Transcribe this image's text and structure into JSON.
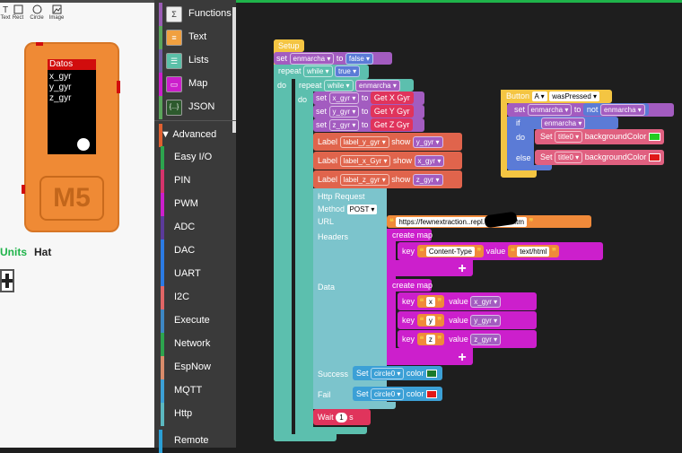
{
  "toolbar": {
    "tools": [
      {
        "label": "Text",
        "icon": "text-tool-icon"
      },
      {
        "label": "Rect",
        "icon": "rect-tool-icon"
      },
      {
        "label": "Circle",
        "icon": "circle-tool-icon"
      },
      {
        "label": "Image",
        "icon": "image-tool-icon"
      }
    ]
  },
  "device": {
    "screen_header": "Datos",
    "screen_lines": [
      "x_gyr",
      "y_gyr",
      "z_gyr"
    ],
    "logo": "M5"
  },
  "tabs": {
    "units": "Units",
    "hat": "Hat",
    "add": "+"
  },
  "categories": {
    "basic": [
      {
        "label": "Functions",
        "color": "#9a5cb4",
        "icon": "Σ"
      },
      {
        "label": "Text",
        "color": "#5ba55b",
        "icon": "≡"
      },
      {
        "label": "Lists",
        "color": "#745ba5",
        "icon": "☰"
      },
      {
        "label": "Map",
        "color": "#cc1fcc",
        "icon": "▭"
      },
      {
        "label": "JSON",
        "color": "#5ba55b",
        "icon": "{...}"
      }
    ],
    "advanced_label": "Advanced",
    "advanced": [
      {
        "label": "Easy I/O",
        "color": "#2da44e"
      },
      {
        "label": "PIN",
        "color": "#d6336c"
      },
      {
        "label": "PWM",
        "color": "#cc1fcc"
      },
      {
        "label": "ADC",
        "color": "#5b3a9a"
      },
      {
        "label": "DAC",
        "color": "#2b7be4"
      },
      {
        "label": "UART",
        "color": "#2b7be4"
      },
      {
        "label": "I2C",
        "color": "#e06666"
      },
      {
        "label": "Execute",
        "color": "#3d87c4"
      },
      {
        "label": "Network",
        "color": "#2da44e"
      },
      {
        "label": "EspNow",
        "color": "#d98c6b"
      },
      {
        "label": "MQTT",
        "color": "#3ca0d6"
      },
      {
        "label": "Http",
        "color": "#5bb8c0"
      },
      {
        "label": "Remote",
        "color": "#2b9fd6"
      }
    ]
  },
  "colors": {
    "setup": "#f4c542",
    "variable": "#a35cc0",
    "loop": "#5cbfae",
    "logic": "#5b7bd6",
    "label": "#e0644c",
    "imu": "#e0345c",
    "http": "#7cc4cc",
    "map": "#cc1fcc",
    "text": "#f08a3a",
    "button": "#f4c542",
    "event": "#e06080"
  },
  "blocks": {
    "setup": "Setup",
    "set1": {
      "kw": "set",
      "var": "enmarcha",
      "to": "to",
      "val": "false"
    },
    "repeat1": {
      "kw": "repeat",
      "mode": "while",
      "val": "true"
    },
    "do": "do",
    "repeat2": {
      "kw": "repeat",
      "mode": "while",
      "var": "enmarcha"
    },
    "gyro": [
      {
        "var": "x_gyr",
        "get": "Get X Gyr"
      },
      {
        "var": "y_gyr",
        "get": "Get Y Gyr"
      },
      {
        "var": "z_gyr",
        "get": "Get Z Gyr"
      }
    ],
    "labels": [
      {
        "name": "label_y_gyr",
        "var": "y_gyr"
      },
      {
        "name": "label_x_Gyr",
        "var": "x_gyr"
      },
      {
        "name": "label_z_gyr",
        "var": "z_gyr"
      }
    ],
    "label_kw": "Label",
    "show_kw": "show",
    "to_kw": "to",
    "http": {
      "title": "Http Request",
      "method_label": "Method",
      "method": "POST",
      "url_label": "URL",
      "url": "https://fewnextraction..repl.co/toma.htm",
      "headers_label": "Headers",
      "data_label": "Data",
      "success_label": "Success",
      "fail_label": "Fail"
    },
    "create_map": "create map",
    "key_kw": "key",
    "value_kw": "value",
    "header_entry": {
      "key": "Content-Type",
      "value": "text/html"
    },
    "data_entries": [
      {
        "key": "x",
        "value": "x_gyr"
      },
      {
        "key": "y",
        "value": "y_gyr"
      },
      {
        "key": "z",
        "value": "z_gyr"
      }
    ],
    "success_set": {
      "kw": "Set",
      "target": "circle0",
      "prop": "color",
      "color": "#1a7a2a"
    },
    "fail_set": {
      "kw": "Set",
      "target": "circle0",
      "prop": "color",
      "color": "#e01818"
    },
    "wait": {
      "kw": "Wait",
      "val": "1",
      "unit": "s"
    },
    "button": {
      "kw": "Button",
      "btn": "A",
      "event": "wasPressed"
    },
    "set2": {
      "kw": "set",
      "var": "enmarcha",
      "to": "to",
      "not": "not",
      "val": "enmarcha"
    },
    "if_kw": "if",
    "if_var": "enmarcha",
    "else_kw": "else",
    "then_set": {
      "kw": "Set",
      "target": "title0",
      "prop": "backgroundColor",
      "color": "#22cc22"
    },
    "else_set": {
      "kw": "Set",
      "target": "title0",
      "prop": "backgroundColor",
      "color": "#e01818"
    }
  }
}
